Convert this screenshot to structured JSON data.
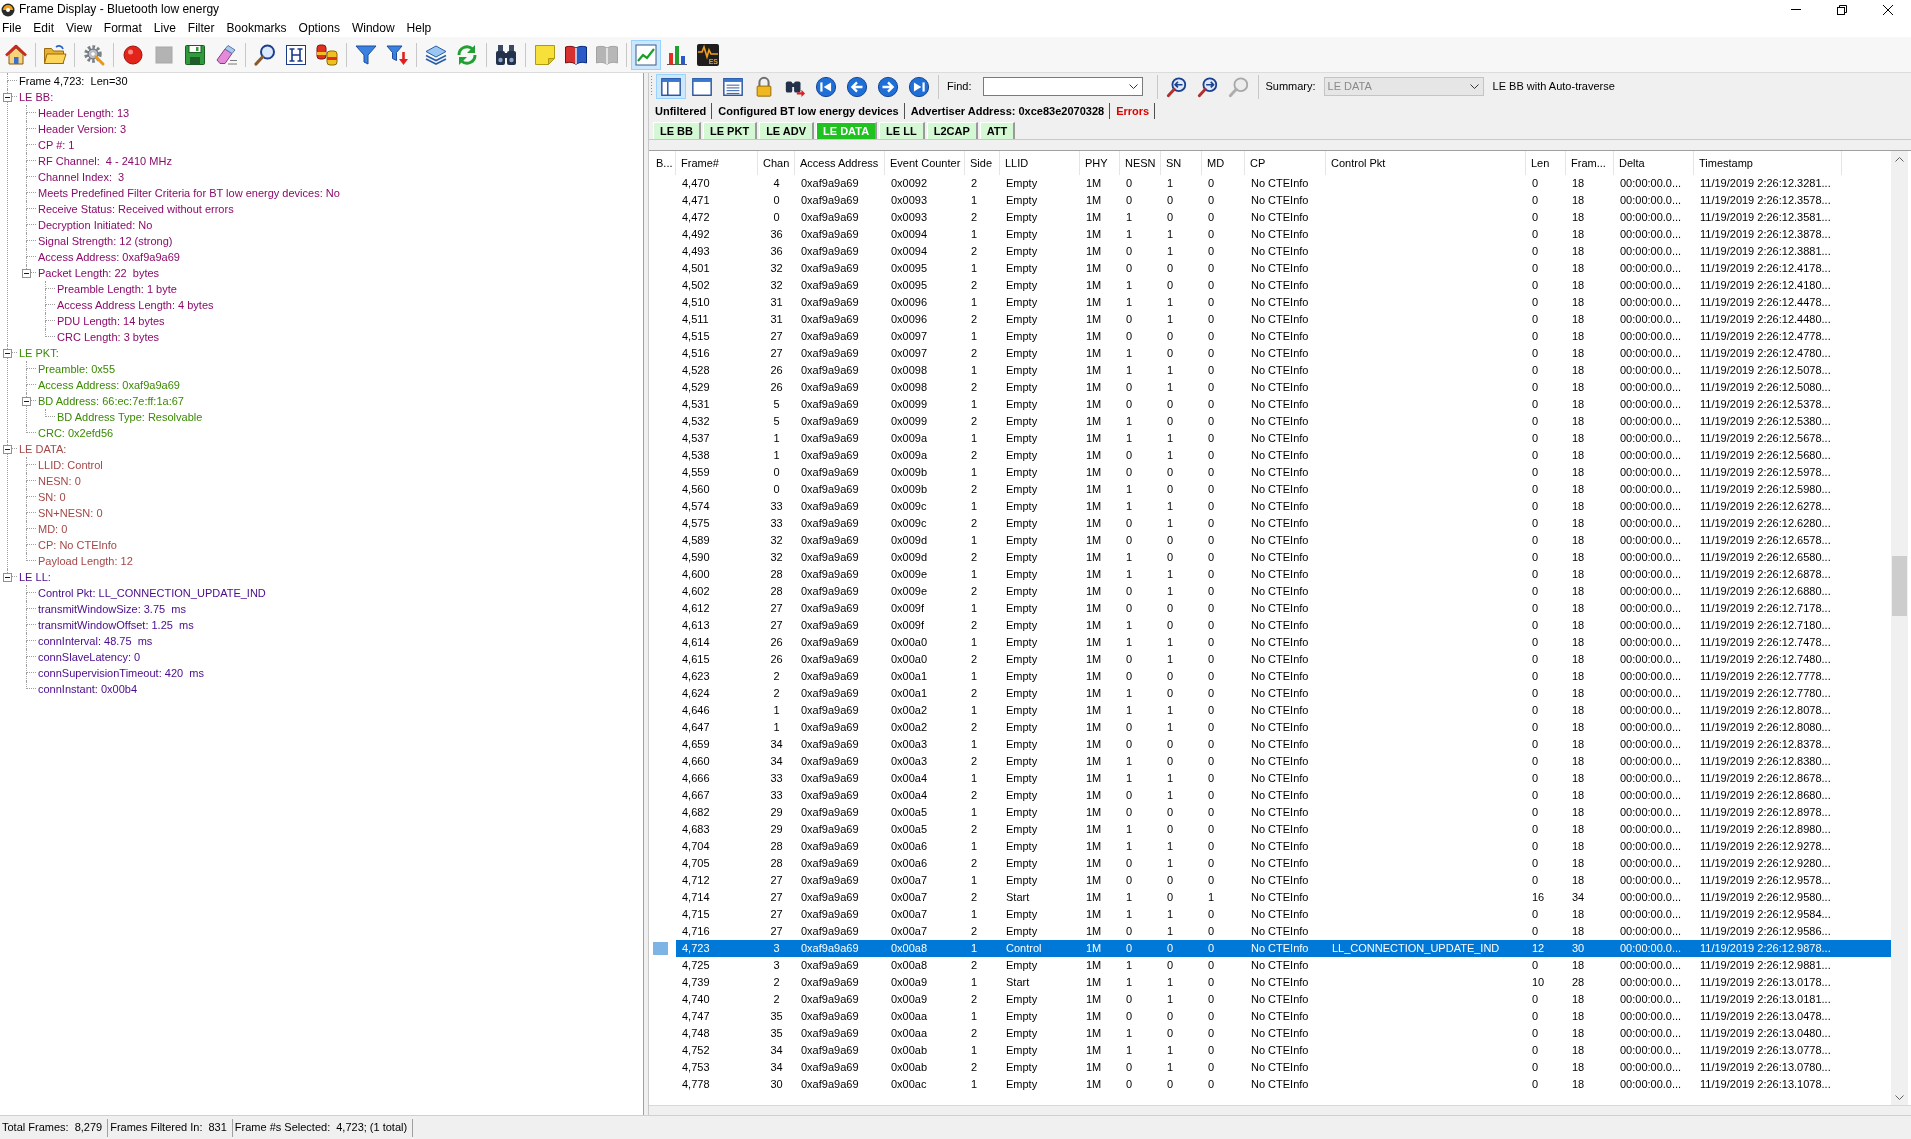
{
  "window": {
    "title": "Frame Display - Bluetooth low energy"
  },
  "menu": [
    "File",
    "Edit",
    "View",
    "Format",
    "Live",
    "Filter",
    "Bookmarks",
    "Options",
    "Window",
    "Help"
  ],
  "toolbar": {
    "groups": [
      [
        {
          "kind": "home",
          "pressed": false,
          "disabled": false
        }
      ],
      [
        {
          "kind": "open",
          "pressed": false,
          "disabled": false
        }
      ],
      [
        {
          "kind": "settings",
          "pressed": false,
          "disabled": false
        }
      ],
      [
        {
          "kind": "record",
          "pressed": false,
          "disabled": false
        },
        {
          "kind": "stop",
          "pressed": false,
          "disabled": true
        },
        {
          "kind": "save",
          "pressed": false,
          "disabled": false
        },
        {
          "kind": "erase",
          "pressed": false,
          "disabled": false
        }
      ],
      [
        {
          "kind": "find",
          "pressed": false,
          "disabled": false
        },
        {
          "kind": "columns",
          "pressed": false,
          "disabled": false
        },
        {
          "kind": "canisters",
          "pressed": false,
          "disabled": false
        }
      ],
      [
        {
          "kind": "filter",
          "pressed": false,
          "disabled": false
        },
        {
          "kind": "filterdown",
          "pressed": false,
          "disabled": false
        }
      ],
      [
        {
          "kind": "layers",
          "pressed": false,
          "disabled": false
        },
        {
          "kind": "refresh",
          "pressed": false,
          "disabled": false
        }
      ],
      [
        {
          "kind": "binoculars",
          "pressed": false,
          "disabled": false
        }
      ],
      [
        {
          "kind": "note",
          "pressed": false,
          "disabled": false
        },
        {
          "kind": "book",
          "pressed": false,
          "disabled": false
        },
        {
          "kind": "book",
          "pressed": false,
          "disabled": true
        }
      ],
      [
        {
          "kind": "linechart",
          "pressed": true,
          "disabled": false
        },
        {
          "kind": "barchart",
          "pressed": false,
          "disabled": false
        },
        {
          "kind": "waveform",
          "pressed": false,
          "disabled": false,
          "label": "ES"
        }
      ]
    ]
  },
  "tree": [
    {
      "label": "Frame 4,723:  Len=30",
      "color": "#000000"
    },
    {
      "label": "LE BB:",
      "color": "#8b0a6b",
      "expanded": true,
      "children": [
        {
          "label": "Header Length: 13"
        },
        {
          "label": "Header Version: 3"
        },
        {
          "label": "CP #: 1"
        },
        {
          "label": "RF Channel:  4 - 2410 MHz"
        },
        {
          "label": "Channel Index:  3"
        },
        {
          "label": "Meets Predefined Filter Criteria for BT low energy devices: No"
        },
        {
          "label": "Receive Status: Received without errors"
        },
        {
          "label": "Decryption Initiated: No"
        },
        {
          "label": "Signal Strength: 12 (strong)"
        },
        {
          "label": "Access Address: 0xaf9a9a69"
        },
        {
          "label": "Packet Length: 22  bytes",
          "expanded": true,
          "children": [
            {
              "label": "Preamble Length: 1 byte"
            },
            {
              "label": "Access Address Length: 4 bytes"
            },
            {
              "label": "PDU Length: 14 bytes"
            },
            {
              "label": "CRC Length: 3 bytes"
            }
          ]
        }
      ]
    },
    {
      "label": "LE PKT:",
      "color": "#3a8a00",
      "expanded": true,
      "children": [
        {
          "label": "Preamble: 0x55"
        },
        {
          "label": "Access Address: 0xaf9a9a69"
        },
        {
          "label": "BD Address: 66:ec:7e:ff:1a:67",
          "expanded": true,
          "children": [
            {
              "label": "BD Address Type: Resolvable"
            }
          ]
        },
        {
          "label": "CRC: 0x2efd56"
        }
      ]
    },
    {
      "label": "LE DATA:",
      "color": "#a34848",
      "expanded": true,
      "children": [
        {
          "label": "LLID: Control"
        },
        {
          "label": "NESN: 0"
        },
        {
          "label": "SN: 0"
        },
        {
          "label": "SN+NESN: 0"
        },
        {
          "label": "MD: 0"
        },
        {
          "label": "CP: No CTEInfo"
        },
        {
          "label": "Payload Length: 12"
        }
      ]
    },
    {
      "label": "LE LL:",
      "color": "#4a0a8c",
      "expanded": true,
      "children": [
        {
          "label": "Control Pkt: LL_CONNECTION_UPDATE_IND"
        },
        {
          "label": "transmitWindowSize: 3.75  ms"
        },
        {
          "label": "transmitWindowOffset: 1.25  ms"
        },
        {
          "label": "connInterval: 48.75  ms"
        },
        {
          "label": "connSlaveLatency: 0"
        },
        {
          "label": "connSupervisionTimeout: 420  ms"
        },
        {
          "label": "connInstant: 0x00b4"
        }
      ]
    }
  ],
  "pane_toolbar": {
    "buttons": [
      {
        "kind": "sidebar",
        "pressed": true,
        "disabled": false
      },
      {
        "kind": "window",
        "pressed": false,
        "disabled": false
      },
      {
        "kind": "list",
        "pressed": false,
        "disabled": false
      },
      {
        "kind": "lock",
        "pressed": false,
        "disabled": false
      },
      {
        "kind": "locate",
        "pressed": false,
        "disabled": false
      },
      {
        "kind": "first",
        "pressed": false,
        "disabled": false
      },
      {
        "kind": "previous",
        "pressed": false,
        "disabled": false
      },
      {
        "kind": "next",
        "pressed": false,
        "disabled": false
      },
      {
        "kind": "last",
        "pressed": false,
        "disabled": false
      }
    ],
    "find_label": "Find:",
    "search_buttons": [
      {
        "kind": "searchback",
        "disabled": false
      },
      {
        "kind": "searchforward",
        "disabled": false
      },
      {
        "kind": "searchclear",
        "disabled": true
      }
    ],
    "summary_label": "Summary:",
    "summary": {
      "value": "LE DATA",
      "disabled": true
    },
    "mode": "LE BB with Auto-traverse"
  },
  "filters": [
    {
      "label": "Unfiltered",
      "color": "#000000"
    },
    {
      "label": "Configured BT low energy devices",
      "color": "#000000"
    },
    {
      "label": "Advertiser Address: 0xce83e2070328",
      "color": "#000000"
    },
    {
      "label": "Errors",
      "color": "#e00000"
    }
  ],
  "tabs": [
    {
      "label": "LE BB",
      "selected": false
    },
    {
      "label": "LE PKT",
      "selected": false
    },
    {
      "label": "LE ADV",
      "selected": false
    },
    {
      "label": "LE DATA",
      "selected": true
    },
    {
      "label": "LE LL",
      "selected": false
    },
    {
      "label": "L2CAP",
      "selected": false
    },
    {
      "label": "ATT",
      "selected": false
    }
  ],
  "table": {
    "columns": [
      "B...",
      "Frame#",
      "Chan",
      "Access Address",
      "Event Counter",
      "Side",
      "LLID",
      "PHY",
      "NESN",
      "SN",
      "MD",
      "CP",
      "Control Pkt",
      "Len",
      "Fram...",
      "Delta",
      "Timestamp"
    ],
    "rows": [
      {
        "selected": false,
        "cells": [
          null,
          "4,470",
          "4",
          "0xaf9a9a69",
          "0x0092",
          "2",
          "Empty",
          "1M",
          "0",
          "1",
          "0",
          "No CTEInfo",
          null,
          "0",
          "18",
          "00:00:00.0...",
          "11/19/2019 2:26:12.3281..."
        ]
      },
      {
        "selected": false,
        "cells": [
          null,
          "4,471",
          "0",
          "0xaf9a9a69",
          "0x0093",
          "1",
          "Empty",
          "1M",
          "0",
          "0",
          "0",
          "No CTEInfo",
          null,
          "0",
          "18",
          "00:00:00.0...",
          "11/19/2019 2:26:12.3578..."
        ]
      },
      {
        "selected": false,
        "cells": [
          null,
          "4,472",
          "0",
          "0xaf9a9a69",
          "0x0093",
          "2",
          "Empty",
          "1M",
          "1",
          "0",
          "0",
          "No CTEInfo",
          null,
          "0",
          "18",
          "00:00:00.0...",
          "11/19/2019 2:26:12.3581..."
        ]
      },
      {
        "selected": false,
        "cells": [
          null,
          "4,492",
          "36",
          "0xaf9a9a69",
          "0x0094",
          "1",
          "Empty",
          "1M",
          "1",
          "1",
          "0",
          "No CTEInfo",
          null,
          "0",
          "18",
          "00:00:00.0...",
          "11/19/2019 2:26:12.3878..."
        ]
      },
      {
        "selected": false,
        "cells": [
          null,
          "4,493",
          "36",
          "0xaf9a9a69",
          "0x0094",
          "2",
          "Empty",
          "1M",
          "0",
          "1",
          "0",
          "No CTEInfo",
          null,
          "0",
          "18",
          "00:00:00.0...",
          "11/19/2019 2:26:12.3881..."
        ]
      },
      {
        "selected": false,
        "cells": [
          null,
          "4,501",
          "32",
          "0xaf9a9a69",
          "0x0095",
          "1",
          "Empty",
          "1M",
          "0",
          "0",
          "0",
          "No CTEInfo",
          null,
          "0",
          "18",
          "00:00:00.0...",
          "11/19/2019 2:26:12.4178..."
        ]
      },
      {
        "selected": false,
        "cells": [
          null,
          "4,502",
          "32",
          "0xaf9a9a69",
          "0x0095",
          "2",
          "Empty",
          "1M",
          "1",
          "0",
          "0",
          "No CTEInfo",
          null,
          "0",
          "18",
          "00:00:00.0...",
          "11/19/2019 2:26:12.4180..."
        ]
      },
      {
        "selected": false,
        "cells": [
          null,
          "4,510",
          "31",
          "0xaf9a9a69",
          "0x0096",
          "1",
          "Empty",
          "1M",
          "1",
          "1",
          "0",
          "No CTEInfo",
          null,
          "0",
          "18",
          "00:00:00.0...",
          "11/19/2019 2:26:12.4478..."
        ]
      },
      {
        "selected": false,
        "cells": [
          null,
          "4,511",
          "31",
          "0xaf9a9a69",
          "0x0096",
          "2",
          "Empty",
          "1M",
          "0",
          "1",
          "0",
          "No CTEInfo",
          null,
          "0",
          "18",
          "00:00:00.0...",
          "11/19/2019 2:26:12.4480..."
        ]
      },
      {
        "selected": false,
        "cells": [
          null,
          "4,515",
          "27",
          "0xaf9a9a69",
          "0x0097",
          "1",
          "Empty",
          "1M",
          "0",
          "0",
          "0",
          "No CTEInfo",
          null,
          "0",
          "18",
          "00:00:00.0...",
          "11/19/2019 2:26:12.4778..."
        ]
      },
      {
        "selected": false,
        "cells": [
          null,
          "4,516",
          "27",
          "0xaf9a9a69",
          "0x0097",
          "2",
          "Empty",
          "1M",
          "1",
          "0",
          "0",
          "No CTEInfo",
          null,
          "0",
          "18",
          "00:00:00.0...",
          "11/19/2019 2:26:12.4780..."
        ]
      },
      {
        "selected": false,
        "cells": [
          null,
          "4,528",
          "26",
          "0xaf9a9a69",
          "0x0098",
          "1",
          "Empty",
          "1M",
          "1",
          "1",
          "0",
          "No CTEInfo",
          null,
          "0",
          "18",
          "00:00:00.0...",
          "11/19/2019 2:26:12.5078..."
        ]
      },
      {
        "selected": false,
        "cells": [
          null,
          "4,529",
          "26",
          "0xaf9a9a69",
          "0x0098",
          "2",
          "Empty",
          "1M",
          "0",
          "1",
          "0",
          "No CTEInfo",
          null,
          "0",
          "18",
          "00:00:00.0...",
          "11/19/2019 2:26:12.5080..."
        ]
      },
      {
        "selected": false,
        "cells": [
          null,
          "4,531",
          "5",
          "0xaf9a9a69",
          "0x0099",
          "1",
          "Empty",
          "1M",
          "0",
          "0",
          "0",
          "No CTEInfo",
          null,
          "0",
          "18",
          "00:00:00.0...",
          "11/19/2019 2:26:12.5378..."
        ]
      },
      {
        "selected": false,
        "cells": [
          null,
          "4,532",
          "5",
          "0xaf9a9a69",
          "0x0099",
          "2",
          "Empty",
          "1M",
          "1",
          "0",
          "0",
          "No CTEInfo",
          null,
          "0",
          "18",
          "00:00:00.0...",
          "11/19/2019 2:26:12.5380..."
        ]
      },
      {
        "selected": false,
        "cells": [
          null,
          "4,537",
          "1",
          "0xaf9a9a69",
          "0x009a",
          "1",
          "Empty",
          "1M",
          "1",
          "1",
          "0",
          "No CTEInfo",
          null,
          "0",
          "18",
          "00:00:00.0...",
          "11/19/2019 2:26:12.5678..."
        ]
      },
      {
        "selected": false,
        "cells": [
          null,
          "4,538",
          "1",
          "0xaf9a9a69",
          "0x009a",
          "2",
          "Empty",
          "1M",
          "0",
          "1",
          "0",
          "No CTEInfo",
          null,
          "0",
          "18",
          "00:00:00.0...",
          "11/19/2019 2:26:12.5680..."
        ]
      },
      {
        "selected": false,
        "cells": [
          null,
          "4,559",
          "0",
          "0xaf9a9a69",
          "0x009b",
          "1",
          "Empty",
          "1M",
          "0",
          "0",
          "0",
          "No CTEInfo",
          null,
          "0",
          "18",
          "00:00:00.0...",
          "11/19/2019 2:26:12.5978..."
        ]
      },
      {
        "selected": false,
        "cells": [
          null,
          "4,560",
          "0",
          "0xaf9a9a69",
          "0x009b",
          "2",
          "Empty",
          "1M",
          "1",
          "0",
          "0",
          "No CTEInfo",
          null,
          "0",
          "18",
          "00:00:00.0...",
          "11/19/2019 2:26:12.5980..."
        ]
      },
      {
        "selected": false,
        "cells": [
          null,
          "4,574",
          "33",
          "0xaf9a9a69",
          "0x009c",
          "1",
          "Empty",
          "1M",
          "1",
          "1",
          "0",
          "No CTEInfo",
          null,
          "0",
          "18",
          "00:00:00.0...",
          "11/19/2019 2:26:12.6278..."
        ]
      },
      {
        "selected": false,
        "cells": [
          null,
          "4,575",
          "33",
          "0xaf9a9a69",
          "0x009c",
          "2",
          "Empty",
          "1M",
          "0",
          "1",
          "0",
          "No CTEInfo",
          null,
          "0",
          "18",
          "00:00:00.0...",
          "11/19/2019 2:26:12.6280..."
        ]
      },
      {
        "selected": false,
        "cells": [
          null,
          "4,589",
          "32",
          "0xaf9a9a69",
          "0x009d",
          "1",
          "Empty",
          "1M",
          "0",
          "0",
          "0",
          "No CTEInfo",
          null,
          "0",
          "18",
          "00:00:00.0...",
          "11/19/2019 2:26:12.6578..."
        ]
      },
      {
        "selected": false,
        "cells": [
          null,
          "4,590",
          "32",
          "0xaf9a9a69",
          "0x009d",
          "2",
          "Empty",
          "1M",
          "1",
          "0",
          "0",
          "No CTEInfo",
          null,
          "0",
          "18",
          "00:00:00.0...",
          "11/19/2019 2:26:12.6580..."
        ]
      },
      {
        "selected": false,
        "cells": [
          null,
          "4,600",
          "28",
          "0xaf9a9a69",
          "0x009e",
          "1",
          "Empty",
          "1M",
          "1",
          "1",
          "0",
          "No CTEInfo",
          null,
          "0",
          "18",
          "00:00:00.0...",
          "11/19/2019 2:26:12.6878..."
        ]
      },
      {
        "selected": false,
        "cells": [
          null,
          "4,602",
          "28",
          "0xaf9a9a69",
          "0x009e",
          "2",
          "Empty",
          "1M",
          "0",
          "1",
          "0",
          "No CTEInfo",
          null,
          "0",
          "18",
          "00:00:00.0...",
          "11/19/2019 2:26:12.6880..."
        ]
      },
      {
        "selected": false,
        "cells": [
          null,
          "4,612",
          "27",
          "0xaf9a9a69",
          "0x009f",
          "1",
          "Empty",
          "1M",
          "0",
          "0",
          "0",
          "No CTEInfo",
          null,
          "0",
          "18",
          "00:00:00.0...",
          "11/19/2019 2:26:12.7178..."
        ]
      },
      {
        "selected": false,
        "cells": [
          null,
          "4,613",
          "27",
          "0xaf9a9a69",
          "0x009f",
          "2",
          "Empty",
          "1M",
          "1",
          "0",
          "0",
          "No CTEInfo",
          null,
          "0",
          "18",
          "00:00:00.0...",
          "11/19/2019 2:26:12.7180..."
        ]
      },
      {
        "selected": false,
        "cells": [
          null,
          "4,614",
          "26",
          "0xaf9a9a69",
          "0x00a0",
          "1",
          "Empty",
          "1M",
          "1",
          "1",
          "0",
          "No CTEInfo",
          null,
          "0",
          "18",
          "00:00:00.0...",
          "11/19/2019 2:26:12.7478..."
        ]
      },
      {
        "selected": false,
        "cells": [
          null,
          "4,615",
          "26",
          "0xaf9a9a69",
          "0x00a0",
          "2",
          "Empty",
          "1M",
          "0",
          "1",
          "0",
          "No CTEInfo",
          null,
          "0",
          "18",
          "00:00:00.0...",
          "11/19/2019 2:26:12.7480..."
        ]
      },
      {
        "selected": false,
        "cells": [
          null,
          "4,623",
          "2",
          "0xaf9a9a69",
          "0x00a1",
          "1",
          "Empty",
          "1M",
          "0",
          "0",
          "0",
          "No CTEInfo",
          null,
          "0",
          "18",
          "00:00:00.0...",
          "11/19/2019 2:26:12.7778..."
        ]
      },
      {
        "selected": false,
        "cells": [
          null,
          "4,624",
          "2",
          "0xaf9a9a69",
          "0x00a1",
          "2",
          "Empty",
          "1M",
          "1",
          "0",
          "0",
          "No CTEInfo",
          null,
          "0",
          "18",
          "00:00:00.0...",
          "11/19/2019 2:26:12.7780..."
        ]
      },
      {
        "selected": false,
        "cells": [
          null,
          "4,646",
          "1",
          "0xaf9a9a69",
          "0x00a2",
          "1",
          "Empty",
          "1M",
          "1",
          "1",
          "0",
          "No CTEInfo",
          null,
          "0",
          "18",
          "00:00:00.0...",
          "11/19/2019 2:26:12.8078..."
        ]
      },
      {
        "selected": false,
        "cells": [
          null,
          "4,647",
          "1",
          "0xaf9a9a69",
          "0x00a2",
          "2",
          "Empty",
          "1M",
          "0",
          "1",
          "0",
          "No CTEInfo",
          null,
          "0",
          "18",
          "00:00:00.0...",
          "11/19/2019 2:26:12.8080..."
        ]
      },
      {
        "selected": false,
        "cells": [
          null,
          "4,659",
          "34",
          "0xaf9a9a69",
          "0x00a3",
          "1",
          "Empty",
          "1M",
          "0",
          "0",
          "0",
          "No CTEInfo",
          null,
          "0",
          "18",
          "00:00:00.0...",
          "11/19/2019 2:26:12.8378..."
        ]
      },
      {
        "selected": false,
        "cells": [
          null,
          "4,660",
          "34",
          "0xaf9a9a69",
          "0x00a3",
          "2",
          "Empty",
          "1M",
          "1",
          "0",
          "0",
          "No CTEInfo",
          null,
          "0",
          "18",
          "00:00:00.0...",
          "11/19/2019 2:26:12.8380..."
        ]
      },
      {
        "selected": false,
        "cells": [
          null,
          "4,666",
          "33",
          "0xaf9a9a69",
          "0x00a4",
          "1",
          "Empty",
          "1M",
          "1",
          "1",
          "0",
          "No CTEInfo",
          null,
          "0",
          "18",
          "00:00:00.0...",
          "11/19/2019 2:26:12.8678..."
        ]
      },
      {
        "selected": false,
        "cells": [
          null,
          "4,667",
          "33",
          "0xaf9a9a69",
          "0x00a4",
          "2",
          "Empty",
          "1M",
          "0",
          "1",
          "0",
          "No CTEInfo",
          null,
          "0",
          "18",
          "00:00:00.0...",
          "11/19/2019 2:26:12.8680..."
        ]
      },
      {
        "selected": false,
        "cells": [
          null,
          "4,682",
          "29",
          "0xaf9a9a69",
          "0x00a5",
          "1",
          "Empty",
          "1M",
          "0",
          "0",
          "0",
          "No CTEInfo",
          null,
          "0",
          "18",
          "00:00:00.0...",
          "11/19/2019 2:26:12.8978..."
        ]
      },
      {
        "selected": false,
        "cells": [
          null,
          "4,683",
          "29",
          "0xaf9a9a69",
          "0x00a5",
          "2",
          "Empty",
          "1M",
          "1",
          "0",
          "0",
          "No CTEInfo",
          null,
          "0",
          "18",
          "00:00:00.0...",
          "11/19/2019 2:26:12.8980..."
        ]
      },
      {
        "selected": false,
        "cells": [
          null,
          "4,704",
          "28",
          "0xaf9a9a69",
          "0x00a6",
          "1",
          "Empty",
          "1M",
          "1",
          "1",
          "0",
          "No CTEInfo",
          null,
          "0",
          "18",
          "00:00:00.0...",
          "11/19/2019 2:26:12.9278..."
        ]
      },
      {
        "selected": false,
        "cells": [
          null,
          "4,705",
          "28",
          "0xaf9a9a69",
          "0x00a6",
          "2",
          "Empty",
          "1M",
          "0",
          "1",
          "0",
          "No CTEInfo",
          null,
          "0",
          "18",
          "00:00:00.0...",
          "11/19/2019 2:26:12.9280..."
        ]
      },
      {
        "selected": false,
        "cells": [
          null,
          "4,712",
          "27",
          "0xaf9a9a69",
          "0x00a7",
          "1",
          "Empty",
          "1M",
          "0",
          "0",
          "0",
          "No CTEInfo",
          null,
          "0",
          "18",
          "00:00:00.0...",
          "11/19/2019 2:26:12.9578..."
        ]
      },
      {
        "selected": false,
        "cells": [
          null,
          "4,714",
          "27",
          "0xaf9a9a69",
          "0x00a7",
          "2",
          "Start",
          "1M",
          "1",
          "0",
          "1",
          "No CTEInfo",
          null,
          "16",
          "34",
          "00:00:00.0...",
          "11/19/2019 2:26:12.9580..."
        ]
      },
      {
        "selected": false,
        "cells": [
          null,
          "4,715",
          "27",
          "0xaf9a9a69",
          "0x00a7",
          "1",
          "Empty",
          "1M",
          "1",
          "1",
          "0",
          "No CTEInfo",
          null,
          "0",
          "18",
          "00:00:00.0...",
          "11/19/2019 2:26:12.9584..."
        ]
      },
      {
        "selected": false,
        "cells": [
          null,
          "4,716",
          "27",
          "0xaf9a9a69",
          "0x00a7",
          "2",
          "Empty",
          "1M",
          "0",
          "1",
          "0",
          "No CTEInfo",
          null,
          "0",
          "18",
          "00:00:00.0...",
          "11/19/2019 2:26:12.9586..."
        ]
      },
      {
        "selected": true,
        "cells": [
          null,
          "4,723",
          "3",
          "0xaf9a9a69",
          "0x00a8",
          "1",
          "Control",
          "1M",
          "0",
          "0",
          "0",
          "No CTEInfo",
          "LL_CONNECTION_UPDATE_IND",
          "12",
          "30",
          "00:00:00.0...",
          "11/19/2019 2:26:12.9878..."
        ]
      },
      {
        "selected": false,
        "cells": [
          null,
          "4,725",
          "3",
          "0xaf9a9a69",
          "0x00a8",
          "2",
          "Empty",
          "1M",
          "1",
          "0",
          "0",
          "No CTEInfo",
          null,
          "0",
          "18",
          "00:00:00.0...",
          "11/19/2019 2:26:12.9881..."
        ]
      },
      {
        "selected": false,
        "cells": [
          null,
          "4,739",
          "2",
          "0xaf9a9a69",
          "0x00a9",
          "1",
          "Start",
          "1M",
          "1",
          "1",
          "0",
          "No CTEInfo",
          null,
          "10",
          "28",
          "00:00:00.0...",
          "11/19/2019 2:26:13.0178..."
        ]
      },
      {
        "selected": false,
        "cells": [
          null,
          "4,740",
          "2",
          "0xaf9a9a69",
          "0x00a9",
          "2",
          "Empty",
          "1M",
          "0",
          "1",
          "0",
          "No CTEInfo",
          null,
          "0",
          "18",
          "00:00:00.0...",
          "11/19/2019 2:26:13.0181..."
        ]
      },
      {
        "selected": false,
        "cells": [
          null,
          "4,747",
          "35",
          "0xaf9a9a69",
          "0x00aa",
          "1",
          "Empty",
          "1M",
          "0",
          "0",
          "0",
          "No CTEInfo",
          null,
          "0",
          "18",
          "00:00:00.0...",
          "11/19/2019 2:26:13.0478..."
        ]
      },
      {
        "selected": false,
        "cells": [
          null,
          "4,748",
          "35",
          "0xaf9a9a69",
          "0x00aa",
          "2",
          "Empty",
          "1M",
          "1",
          "0",
          "0",
          "No CTEInfo",
          null,
          "0",
          "18",
          "00:00:00.0...",
          "11/19/2019 2:26:13.0480..."
        ]
      },
      {
        "selected": false,
        "cells": [
          null,
          "4,752",
          "34",
          "0xaf9a9a69",
          "0x00ab",
          "1",
          "Empty",
          "1M",
          "1",
          "1",
          "0",
          "No CTEInfo",
          null,
          "0",
          "18",
          "00:00:00.0...",
          "11/19/2019 2:26:13.0778..."
        ]
      },
      {
        "selected": false,
        "cells": [
          null,
          "4,753",
          "34",
          "0xaf9a9a69",
          "0x00ab",
          "2",
          "Empty",
          "1M",
          "0",
          "1",
          "0",
          "No CTEInfo",
          null,
          "0",
          "18",
          "00:00:00.0...",
          "11/19/2019 2:26:13.0780..."
        ]
      },
      {
        "selected": false,
        "cells": [
          null,
          "4,778",
          "30",
          "0xaf9a9a69",
          "0x00ac",
          "1",
          "Empty",
          "1M",
          "0",
          "0",
          "0",
          "No CTEInfo",
          null,
          "0",
          "18",
          "00:00:00.0...",
          "11/19/2019 2:26:13.1078..."
        ]
      }
    ]
  },
  "status_bar": [
    {
      "label": "Total Frames:",
      "value": "8,279"
    },
    {
      "label": "Frames Filtered In:",
      "value": "831"
    },
    {
      "label": "Frame #s Selected:",
      "value": "4,723; (1 total)"
    }
  ]
}
